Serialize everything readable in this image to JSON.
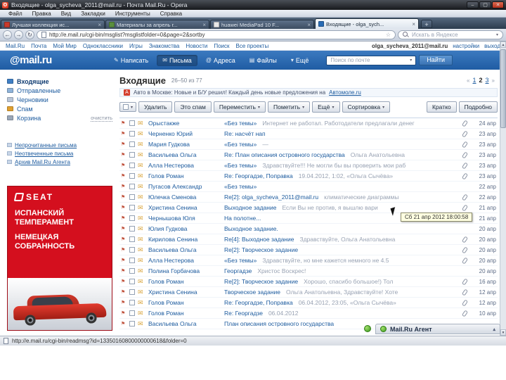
{
  "icons": {
    "opera": "O",
    "minimize": "–",
    "maximize": "▢",
    "close": "✕",
    "close_small": "×",
    "plus": "+",
    "back": "←",
    "forward": "→",
    "reload": "↻",
    "dropdown_small": "▾",
    "envelope": "✉",
    "flag": "⚑",
    "star": "☆",
    "prev": "«",
    "next": "»",
    "up": "▲",
    "down": "▼",
    "collapse": "▴"
  },
  "window": {
    "title": "Входящие - olga_sycheva_2011@mail.ru - Почта Mail.Ru - Opera",
    "menu": [
      "Файл",
      "Правка",
      "Вид",
      "Закладки",
      "Инструменты",
      "Справка"
    ]
  },
  "tabs": [
    {
      "label": "Лучшая коллекция ис...",
      "fav": "#c93a2c",
      "active": false
    },
    {
      "label": "Материалы за апрель г...",
      "fav": "#5a8f3d",
      "active": false
    },
    {
      "label": "huawei MediaPad 10 F...",
      "fav": "#e8e8e8",
      "active": false
    },
    {
      "label": "Входящие - olga_sych...",
      "fav": "#2a6cb5",
      "active": true
    }
  ],
  "address_bar": {
    "url": "http://e.mail.ru/cgi-bin/msglist?msglistfolder=0&page=2&sortby",
    "search_placeholder": "Искать в Яндексе"
  },
  "top_nav": {
    "items": [
      "Mail.Ru",
      "Почта",
      "Мой Мир",
      "Одноклассники",
      "Игры",
      "Знакомства",
      "Новости",
      "Поиск",
      "Все проекты"
    ],
    "account": "olga_sycheva_2011@mail.ru",
    "settings": "настройки",
    "logout": "выход"
  },
  "mail_header": {
    "logo": "@mail.ru",
    "buttons": [
      {
        "label": "Написать",
        "icon": "✎",
        "active": false
      },
      {
        "label": "Письма",
        "icon": "✉",
        "active": true
      },
      {
        "label": "Адреса",
        "icon": "@",
        "active": false
      },
      {
        "label": "Файлы",
        "icon": "▤",
        "active": false
      },
      {
        "label": "Ещё",
        "icon": "▾",
        "active": false
      }
    ],
    "search_placeholder": "Поиск по почте",
    "search_button": "Найти"
  },
  "sidebar": {
    "folders": [
      {
        "label": "Входящие",
        "icon_color": "#3f7fc4",
        "active": true,
        "action": ""
      },
      {
        "label": "Отправленные",
        "icon_color": "#8fb3d9",
        "active": false,
        "action": ""
      },
      {
        "label": "Черновики",
        "icon_color": "#b9c6d8",
        "active": false,
        "action": ""
      },
      {
        "label": "Спам",
        "icon_color": "#e0a030",
        "active": false,
        "action": ""
      },
      {
        "label": "Корзина",
        "icon_color": "#9aa7b8",
        "active": false,
        "action": "очистить"
      }
    ],
    "links": [
      "Непрочитанные письма",
      "Неотвеченные письма",
      "Архив Mail.Ru Агента"
    ],
    "ad": {
      "brand": "SEAT",
      "line1": "ИСПАНСКИЙ ТЕМПЕРАМЕНТ",
      "line2": "НЕМЕЦКАЯ СОБРАННОСТЬ"
    }
  },
  "mailbox": {
    "title": "Входящие",
    "range": "26–50 из 77",
    "pages": [
      {
        "n": "1",
        "current": false
      },
      {
        "n": "2",
        "current": true
      },
      {
        "n": "3",
        "current": false
      }
    ],
    "notice_icon": "А",
    "notice_text": "Авто в Москве: Новые и Б/У решил! Каждый день новые предложения на",
    "notice_link": "Автомоле.ru",
    "toolbar": [
      {
        "label": "Удалить",
        "dropdown": false
      },
      {
        "label": "Это спам",
        "dropdown": false
      },
      {
        "label": "Переместить",
        "dropdown": true
      },
      {
        "label": "Пометить",
        "dropdown": true
      },
      {
        "label": "Ещё",
        "dropdown": true
      },
      {
        "label": "Сортировка",
        "dropdown": true
      }
    ],
    "view_buttons": [
      {
        "label": "Кратко",
        "dropdown": false
      },
      {
        "label": "Подробно",
        "dropdown": false
      }
    ],
    "emails": [
      {
        "sender": "Орыстакже",
        "subject": "«Без темы»",
        "snippet": "Интернет не работал. Работодатели предлагали денег",
        "date": "24 апр",
        "attach": true
      },
      {
        "sender": "Черненко Юрий",
        "subject": "Re: насчёт нап",
        "snippet": "",
        "date": "23 апр",
        "attach": true
      },
      {
        "sender": "Мария Гудкова",
        "subject": "«Без темы»",
        "snippet": "—",
        "date": "23 апр",
        "attach": true
      },
      {
        "sender": "Васильева Ольга",
        "subject": "Re: План описания островного государства",
        "snippet": "Ольга Анатольевна",
        "date": "23 апр",
        "attach": true
      },
      {
        "sender": "Алла Нестерова",
        "subject": "«Без темы»",
        "snippet": "Здравствуйте!!! Не могли бы вы проверить мои раб",
        "date": "23 апр",
        "attach": true
      },
      {
        "sender": "Голов Роман",
        "subject": "Re: Георгадзе, Поправка",
        "snippet": "19.04.2012, 1:02, «Ольга Сычёва»",
        "date": "23 апр",
        "attach": true
      },
      {
        "sender": "Пугасов Александр",
        "subject": "«Без темы»",
        "snippet": "",
        "date": "22 апр",
        "attach": false
      },
      {
        "sender": "Юлечка Сменова",
        "subject": "Re[2]: olga_sycheva_2011@mail.ru",
        "snippet": "климатические диаграммы",
        "date": "22 апр",
        "attach": true
      },
      {
        "sender": "Христина Сенина",
        "subject": "Выходное задание",
        "snippet": "Если Вы не против, я вышлю вари",
        "date": "21 апр",
        "attach": true
      },
      {
        "sender": "Чернышова Юля",
        "subject": "На полотне...",
        "snippet": "",
        "date": "21 апр",
        "attach": true
      },
      {
        "sender": "Юлия Гудкова",
        "subject": "Выходное задание.",
        "snippet": "",
        "date": "20 апр",
        "attach": false
      },
      {
        "sender": "Кирилова Сенина",
        "subject": "Re[4]: Выходное задание",
        "snippet": "Здравствуйте, Ольга Анатольевна",
        "date": "20 апр",
        "attach": true
      },
      {
        "sender": "Васильева Ольга",
        "subject": "Re[2]: Творческое задание",
        "snippet": "",
        "date": "20 апр",
        "attach": true
      },
      {
        "sender": "Алла Нестерова",
        "subject": "«Без темы»",
        "snippet": "Здравствуйте, но мне кажется немного не 4.5",
        "date": "20 апр",
        "attach": true
      },
      {
        "sender": "Полина Горбачова",
        "subject": "Георгадзе",
        "snippet": "Христос Воскрес!",
        "date": "20 апр",
        "attach": false
      },
      {
        "sender": "Голов Роман",
        "subject": "Re[2]: Творческое задание",
        "snippet": "Хорошо, спасибо большое!) Тол",
        "date": "16 апр",
        "attach": true
      },
      {
        "sender": "Христина Сенина",
        "subject": "Творческое задание",
        "snippet": "Ольга Анатольевна, Здравствуйте! Хоте",
        "date": "12 апр",
        "attach": true
      },
      {
        "sender": "Голов Роман",
        "subject": "Re: Георгадзе, Поправка",
        "snippet": "06.04.2012, 23:05, «Ольга Сычёва»",
        "date": "12 апр",
        "attach": true
      },
      {
        "sender": "Голов Роман",
        "subject": "Re: Георгадзе",
        "snippet": "06.04.2012",
        "date": "10 апр",
        "attach": true
      },
      {
        "sender": "Васильева Ольга",
        "subject": "План описания островного государства",
        "snippet": "",
        "date": "",
        "attach": false
      }
    ]
  },
  "tooltip": "Сб 21 апр 2012 18:00:58",
  "agent": {
    "label": "Mail.Ru Агент"
  },
  "status_bar": {
    "url": "http://e.mail.ru/cgi-bin/readmsg?id=13350160800000000618&folder=0"
  }
}
